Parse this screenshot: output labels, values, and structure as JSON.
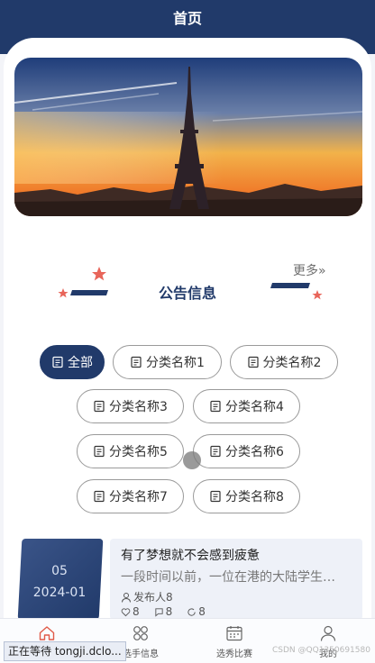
{
  "header": {
    "title": "首页"
  },
  "banner": {
    "alt": ""
  },
  "notice": {
    "title": "公告信息",
    "more_label": "更多»"
  },
  "categories": [
    "全部",
    "分类名称1",
    "分类名称2",
    "分类名称3",
    "分类名称4",
    "分类名称5",
    "分类名称6",
    "分类名称7",
    "分类名称8"
  ],
  "active_category": "全部",
  "article": {
    "day": "05",
    "year_month": "2024-01",
    "title": "有了梦想就不会感到疲惫",
    "summary": "一段时间以前，一位在港的大陆学生…",
    "publisher": "发布人8",
    "likes": "8",
    "comments": "8",
    "views": "8"
  },
  "tabs": [
    {
      "label": "",
      "icon": "home-icon",
      "active": true
    },
    {
      "label": "选手信息",
      "icon": "grid-icon",
      "active": false
    },
    {
      "label": "选秀比赛",
      "icon": "calendar-icon",
      "active": false
    },
    {
      "label": "我的",
      "icon": "user-icon",
      "active": false
    }
  ],
  "status_text": "正在等待 tongji.dclo...",
  "watermark": "CSDN @QQ1350691580",
  "colors": {
    "primary": "#213a6a",
    "accent": "#e05a48",
    "star": "#e8655a"
  }
}
